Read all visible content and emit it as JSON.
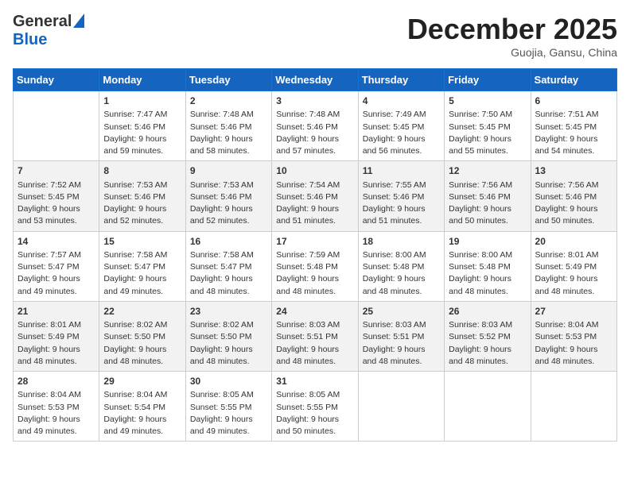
{
  "header": {
    "logo_general": "General",
    "logo_blue": "Blue",
    "month_title": "December 2025",
    "subtitle": "Guojia, Gansu, China"
  },
  "days_of_week": [
    "Sunday",
    "Monday",
    "Tuesday",
    "Wednesday",
    "Thursday",
    "Friday",
    "Saturday"
  ],
  "weeks": [
    [
      {
        "day": "",
        "sunrise": "",
        "sunset": "",
        "daylight": ""
      },
      {
        "day": "1",
        "sunrise": "Sunrise: 7:47 AM",
        "sunset": "Sunset: 5:46 PM",
        "daylight": "Daylight: 9 hours and 59 minutes."
      },
      {
        "day": "2",
        "sunrise": "Sunrise: 7:48 AM",
        "sunset": "Sunset: 5:46 PM",
        "daylight": "Daylight: 9 hours and 58 minutes."
      },
      {
        "day": "3",
        "sunrise": "Sunrise: 7:48 AM",
        "sunset": "Sunset: 5:46 PM",
        "daylight": "Daylight: 9 hours and 57 minutes."
      },
      {
        "day": "4",
        "sunrise": "Sunrise: 7:49 AM",
        "sunset": "Sunset: 5:45 PM",
        "daylight": "Daylight: 9 hours and 56 minutes."
      },
      {
        "day": "5",
        "sunrise": "Sunrise: 7:50 AM",
        "sunset": "Sunset: 5:45 PM",
        "daylight": "Daylight: 9 hours and 55 minutes."
      },
      {
        "day": "6",
        "sunrise": "Sunrise: 7:51 AM",
        "sunset": "Sunset: 5:45 PM",
        "daylight": "Daylight: 9 hours and 54 minutes."
      }
    ],
    [
      {
        "day": "7",
        "sunrise": "Sunrise: 7:52 AM",
        "sunset": "Sunset: 5:45 PM",
        "daylight": "Daylight: 9 hours and 53 minutes."
      },
      {
        "day": "8",
        "sunrise": "Sunrise: 7:53 AM",
        "sunset": "Sunset: 5:46 PM",
        "daylight": "Daylight: 9 hours and 52 minutes."
      },
      {
        "day": "9",
        "sunrise": "Sunrise: 7:53 AM",
        "sunset": "Sunset: 5:46 PM",
        "daylight": "Daylight: 9 hours and 52 minutes."
      },
      {
        "day": "10",
        "sunrise": "Sunrise: 7:54 AM",
        "sunset": "Sunset: 5:46 PM",
        "daylight": "Daylight: 9 hours and 51 minutes."
      },
      {
        "day": "11",
        "sunrise": "Sunrise: 7:55 AM",
        "sunset": "Sunset: 5:46 PM",
        "daylight": "Daylight: 9 hours and 51 minutes."
      },
      {
        "day": "12",
        "sunrise": "Sunrise: 7:56 AM",
        "sunset": "Sunset: 5:46 PM",
        "daylight": "Daylight: 9 hours and 50 minutes."
      },
      {
        "day": "13",
        "sunrise": "Sunrise: 7:56 AM",
        "sunset": "Sunset: 5:46 PM",
        "daylight": "Daylight: 9 hours and 50 minutes."
      }
    ],
    [
      {
        "day": "14",
        "sunrise": "Sunrise: 7:57 AM",
        "sunset": "Sunset: 5:47 PM",
        "daylight": "Daylight: 9 hours and 49 minutes."
      },
      {
        "day": "15",
        "sunrise": "Sunrise: 7:58 AM",
        "sunset": "Sunset: 5:47 PM",
        "daylight": "Daylight: 9 hours and 49 minutes."
      },
      {
        "day": "16",
        "sunrise": "Sunrise: 7:58 AM",
        "sunset": "Sunset: 5:47 PM",
        "daylight": "Daylight: 9 hours and 48 minutes."
      },
      {
        "day": "17",
        "sunrise": "Sunrise: 7:59 AM",
        "sunset": "Sunset: 5:48 PM",
        "daylight": "Daylight: 9 hours and 48 minutes."
      },
      {
        "day": "18",
        "sunrise": "Sunrise: 8:00 AM",
        "sunset": "Sunset: 5:48 PM",
        "daylight": "Daylight: 9 hours and 48 minutes."
      },
      {
        "day": "19",
        "sunrise": "Sunrise: 8:00 AM",
        "sunset": "Sunset: 5:48 PM",
        "daylight": "Daylight: 9 hours and 48 minutes."
      },
      {
        "day": "20",
        "sunrise": "Sunrise: 8:01 AM",
        "sunset": "Sunset: 5:49 PM",
        "daylight": "Daylight: 9 hours and 48 minutes."
      }
    ],
    [
      {
        "day": "21",
        "sunrise": "Sunrise: 8:01 AM",
        "sunset": "Sunset: 5:49 PM",
        "daylight": "Daylight: 9 hours and 48 minutes."
      },
      {
        "day": "22",
        "sunrise": "Sunrise: 8:02 AM",
        "sunset": "Sunset: 5:50 PM",
        "daylight": "Daylight: 9 hours and 48 minutes."
      },
      {
        "day": "23",
        "sunrise": "Sunrise: 8:02 AM",
        "sunset": "Sunset: 5:50 PM",
        "daylight": "Daylight: 9 hours and 48 minutes."
      },
      {
        "day": "24",
        "sunrise": "Sunrise: 8:03 AM",
        "sunset": "Sunset: 5:51 PM",
        "daylight": "Daylight: 9 hours and 48 minutes."
      },
      {
        "day": "25",
        "sunrise": "Sunrise: 8:03 AM",
        "sunset": "Sunset: 5:51 PM",
        "daylight": "Daylight: 9 hours and 48 minutes."
      },
      {
        "day": "26",
        "sunrise": "Sunrise: 8:03 AM",
        "sunset": "Sunset: 5:52 PM",
        "daylight": "Daylight: 9 hours and 48 minutes."
      },
      {
        "day": "27",
        "sunrise": "Sunrise: 8:04 AM",
        "sunset": "Sunset: 5:53 PM",
        "daylight": "Daylight: 9 hours and 48 minutes."
      }
    ],
    [
      {
        "day": "28",
        "sunrise": "Sunrise: 8:04 AM",
        "sunset": "Sunset: 5:53 PM",
        "daylight": "Daylight: 9 hours and 49 minutes."
      },
      {
        "day": "29",
        "sunrise": "Sunrise: 8:04 AM",
        "sunset": "Sunset: 5:54 PM",
        "daylight": "Daylight: 9 hours and 49 minutes."
      },
      {
        "day": "30",
        "sunrise": "Sunrise: 8:05 AM",
        "sunset": "Sunset: 5:55 PM",
        "daylight": "Daylight: 9 hours and 49 minutes."
      },
      {
        "day": "31",
        "sunrise": "Sunrise: 8:05 AM",
        "sunset": "Sunset: 5:55 PM",
        "daylight": "Daylight: 9 hours and 50 minutes."
      },
      {
        "day": "",
        "sunrise": "",
        "sunset": "",
        "daylight": ""
      },
      {
        "day": "",
        "sunrise": "",
        "sunset": "",
        "daylight": ""
      },
      {
        "day": "",
        "sunrise": "",
        "sunset": "",
        "daylight": ""
      }
    ]
  ]
}
